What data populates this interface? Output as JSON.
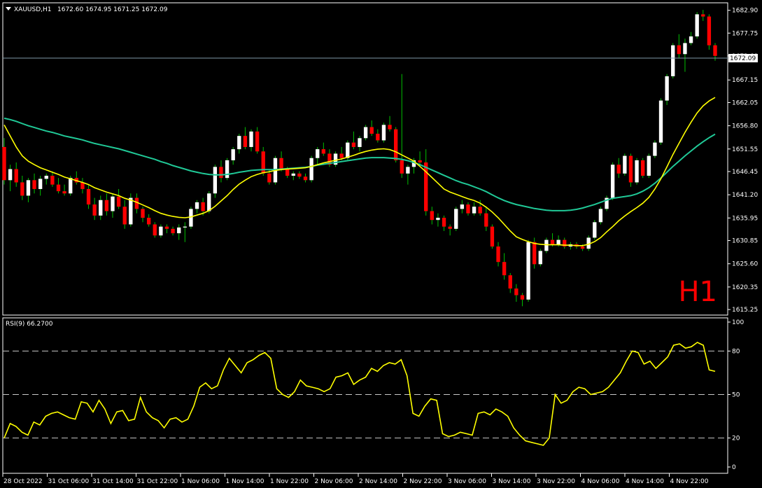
{
  "header": {
    "symbol_label": "XAUUSD,H1",
    "ohlc": "1672.60 1674.95 1671.25 1672.09"
  },
  "colors": {
    "background": "#000000",
    "frame": "#ffffff",
    "up_candle": "#ffffff",
    "down_candle": "#ff0000",
    "wick": "#00c000",
    "ma_fast": "#ffff00",
    "ma_slow": "#20c997",
    "rsi_line": "#ffff00",
    "level_dash": "#c8c8c8",
    "price_line": "#7f98a8",
    "timeframe_text": "#ff0000"
  },
  "timeframe_badge": "H1",
  "chart_data": [
    {
      "type": "candlestick",
      "title": "XAUUSD,H1",
      "ylim": [
        1614.0,
        1684.6
      ],
      "y_ticks": [
        "1682.90",
        "1677.75",
        "1672.60",
        "1667.15",
        "1662.05",
        "1656.80",
        "1651.55",
        "1646.45",
        "1641.20",
        "1635.95",
        "1630.85",
        "1625.60",
        "1620.35",
        "1615.25"
      ],
      "current_price": "1672.09",
      "x_tick_labels": [
        "28 Oct 2022",
        "31 Oct 06:00",
        "31 Oct 14:00",
        "31 Oct 22:00",
        "1 Nov 06:00",
        "1 Nov 14:00",
        "1 Nov 22:00",
        "2 Nov 06:00",
        "2 Nov 14:00",
        "2 Nov 22:00",
        "3 Nov 06:00",
        "3 Nov 14:00",
        "3 Nov 22:00",
        "4 Nov 06:00",
        "4 Nov 14:00",
        "4 Nov 22:00"
      ],
      "candles": [
        [
          1652.0,
          1654.0,
          1643.5,
          1644.5
        ],
        [
          1644.5,
          1648.0,
          1642.0,
          1647.0
        ],
        [
          1647.0,
          1648.5,
          1643.0,
          1644.0
        ],
        [
          1644.0,
          1645.5,
          1640.0,
          1641.0
        ],
        [
          1641.0,
          1645.0,
          1639.5,
          1644.5
        ],
        [
          1644.5,
          1646.0,
          1641.5,
          1642.5
        ],
        [
          1642.5,
          1645.5,
          1641.0,
          1644.8
        ],
        [
          1644.8,
          1646.0,
          1643.5,
          1645.5
        ],
        [
          1645.5,
          1646.5,
          1643.0,
          1643.5
        ],
        [
          1643.5,
          1645.0,
          1641.5,
          1642.0
        ],
        [
          1642.0,
          1643.5,
          1641.0,
          1641.5
        ],
        [
          1641.5,
          1645.5,
          1641.0,
          1645.0
        ],
        [
          1645.0,
          1646.5,
          1643.5,
          1644.0
        ],
        [
          1644.0,
          1645.0,
          1641.5,
          1642.5
        ],
        [
          1642.5,
          1643.5,
          1638.0,
          1639.0
        ],
        [
          1639.0,
          1640.5,
          1635.5,
          1636.5
        ],
        [
          1636.5,
          1641.0,
          1635.5,
          1640.0
        ],
        [
          1640.0,
          1641.5,
          1636.5,
          1637.5
        ],
        [
          1637.5,
          1641.5,
          1636.0,
          1640.8
        ],
        [
          1640.8,
          1642.5,
          1638.0,
          1638.5
        ],
        [
          1638.5,
          1640.0,
          1633.5,
          1634.5
        ],
        [
          1634.5,
          1641.5,
          1634.0,
          1640.5
        ],
        [
          1640.5,
          1641.5,
          1637.0,
          1638.0
        ],
        [
          1638.0,
          1638.5,
          1635.0,
          1636.0
        ],
        [
          1636.0,
          1636.8,
          1634.0,
          1634.5
        ],
        [
          1634.5,
          1635.0,
          1631.5,
          1632.0
        ],
        [
          1632.0,
          1634.5,
          1631.5,
          1634.0
        ],
        [
          1634.0,
          1634.5,
          1632.5,
          1633.5
        ],
        [
          1633.5,
          1634.0,
          1632.0,
          1632.5
        ],
        [
          1632.5,
          1634.5,
          1631.0,
          1633.8
        ],
        [
          1633.8,
          1635.0,
          1630.5,
          1634.0
        ],
        [
          1634.0,
          1638.5,
          1633.5,
          1638.0
        ],
        [
          1638.0,
          1640.0,
          1637.0,
          1639.5
        ],
        [
          1639.5,
          1640.5,
          1636.5,
          1637.5
        ],
        [
          1637.5,
          1642.0,
          1637.0,
          1641.5
        ],
        [
          1641.5,
          1648.0,
          1640.5,
          1647.5
        ],
        [
          1647.5,
          1649.0,
          1644.0,
          1645.0
        ],
        [
          1645.0,
          1649.5,
          1644.5,
          1649.0
        ],
        [
          1649.0,
          1652.0,
          1648.0,
          1651.5
        ],
        [
          1651.5,
          1655.0,
          1650.5,
          1654.5
        ],
        [
          1654.5,
          1656.5,
          1651.5,
          1652.0
        ],
        [
          1652.0,
          1656.0,
          1651.0,
          1655.5
        ],
        [
          1655.5,
          1656.5,
          1650.5,
          1651.0
        ],
        [
          1651.0,
          1652.0,
          1645.5,
          1646.0
        ],
        [
          1646.0,
          1647.0,
          1643.5,
          1644.0
        ],
        [
          1644.0,
          1650.0,
          1643.5,
          1649.5
        ],
        [
          1649.5,
          1651.0,
          1646.5,
          1647.0
        ],
        [
          1647.0,
          1647.5,
          1645.0,
          1645.5
        ],
        [
          1645.5,
          1646.5,
          1644.5,
          1646.0
        ],
        [
          1646.0,
          1646.5,
          1644.8,
          1645.3
        ],
        [
          1645.3,
          1646.0,
          1644.0,
          1644.5
        ],
        [
          1644.5,
          1650.0,
          1644.0,
          1649.5
        ],
        [
          1649.5,
          1652.0,
          1648.0,
          1651.5
        ],
        [
          1651.5,
          1653.0,
          1650.0,
          1650.5
        ],
        [
          1650.5,
          1651.5,
          1647.5,
          1648.0
        ],
        [
          1648.0,
          1651.0,
          1647.5,
          1650.5
        ],
        [
          1650.5,
          1652.0,
          1649.0,
          1649.5
        ],
        [
          1649.5,
          1653.5,
          1649.0,
          1653.0
        ],
        [
          1653.0,
          1655.5,
          1651.5,
          1652.0
        ],
        [
          1652.0,
          1654.5,
          1651.0,
          1654.0
        ],
        [
          1654.0,
          1657.0,
          1653.5,
          1656.5
        ],
        [
          1656.5,
          1658.0,
          1654.5,
          1655.0
        ],
        [
          1655.0,
          1656.0,
          1653.0,
          1653.5
        ],
        [
          1653.5,
          1657.5,
          1653.0,
          1657.0
        ],
        [
          1657.0,
          1659.0,
          1655.5,
          1656.0
        ],
        [
          1656.0,
          1656.5,
          1648.5,
          1649.0
        ],
        [
          1649.0,
          1668.5,
          1645.0,
          1646.0
        ],
        [
          1646.0,
          1648.0,
          1643.5,
          1647.5
        ],
        [
          1647.5,
          1649.5,
          1646.0,
          1649.0
        ],
        [
          1649.0,
          1651.0,
          1647.5,
          1648.5
        ],
        [
          1648.5,
          1651.5,
          1636.5,
          1637.5
        ],
        [
          1637.5,
          1638.5,
          1634.5,
          1635.5
        ],
        [
          1635.5,
          1637.0,
          1634.0,
          1636.0
        ],
        [
          1636.0,
          1636.5,
          1633.0,
          1634.0
        ],
        [
          1634.0,
          1634.5,
          1632.0,
          1633.5
        ],
        [
          1633.5,
          1638.5,
          1633.0,
          1638.0
        ],
        [
          1638.0,
          1640.0,
          1637.0,
          1639.0
        ],
        [
          1639.0,
          1639.5,
          1636.5,
          1637.0
        ],
        [
          1637.0,
          1639.5,
          1636.5,
          1638.5
        ],
        [
          1638.5,
          1640.0,
          1636.5,
          1637.0
        ],
        [
          1637.0,
          1638.5,
          1633.0,
          1634.0
        ],
        [
          1634.0,
          1634.5,
          1629.0,
          1629.5
        ],
        [
          1629.5,
          1630.5,
          1625.0,
          1626.0
        ],
        [
          1626.0,
          1628.0,
          1622.0,
          1623.0
        ],
        [
          1623.0,
          1623.5,
          1619.0,
          1620.0
        ],
        [
          1620.0,
          1621.0,
          1617.0,
          1618.5
        ],
        [
          1618.5,
          1619.0,
          1616.0,
          1617.5
        ],
        [
          1617.5,
          1631.0,
          1617.0,
          1630.5
        ],
        [
          1630.5,
          1631.5,
          1624.5,
          1625.5
        ],
        [
          1625.5,
          1629.0,
          1625.0,
          1628.5
        ],
        [
          1628.5,
          1631.5,
          1628.0,
          1631.0
        ],
        [
          1631.0,
          1632.5,
          1629.5,
          1630.0
        ],
        [
          1630.0,
          1632.0,
          1629.5,
          1631.0
        ],
        [
          1631.0,
          1631.5,
          1629.0,
          1629.5
        ],
        [
          1629.5,
          1630.5,
          1628.8,
          1630.0
        ],
        [
          1630.0,
          1630.5,
          1629.0,
          1629.5
        ],
        [
          1629.5,
          1630.0,
          1628.5,
          1629.0
        ],
        [
          1629.0,
          1632.0,
          1628.5,
          1631.5
        ],
        [
          1631.5,
          1635.5,
          1631.0,
          1635.0
        ],
        [
          1635.0,
          1638.5,
          1634.5,
          1638.0
        ],
        [
          1638.0,
          1641.0,
          1637.5,
          1640.5
        ],
        [
          1640.5,
          1648.5,
          1640.0,
          1648.0
        ],
        [
          1648.0,
          1649.5,
          1645.0,
          1646.0
        ],
        [
          1646.0,
          1650.5,
          1645.5,
          1650.0
        ],
        [
          1650.0,
          1650.5,
          1643.0,
          1644.0
        ],
        [
          1644.0,
          1649.5,
          1643.5,
          1649.0
        ],
        [
          1649.0,
          1649.5,
          1645.0,
          1645.5
        ],
        [
          1645.5,
          1650.5,
          1645.0,
          1650.0
        ],
        [
          1650.0,
          1653.5,
          1649.5,
          1653.0
        ],
        [
          1653.0,
          1663.0,
          1652.5,
          1662.5
        ],
        [
          1662.5,
          1668.5,
          1661.5,
          1668.0
        ],
        [
          1668.0,
          1675.5,
          1667.5,
          1675.0
        ],
        [
          1675.0,
          1677.5,
          1672.0,
          1673.0
        ],
        [
          1673.0,
          1676.5,
          1669.0,
          1675.5
        ],
        [
          1675.5,
          1678.0,
          1675.0,
          1677.0
        ],
        [
          1677.0,
          1682.5,
          1676.5,
          1682.0
        ],
        [
          1682.0,
          1683.0,
          1680.5,
          1681.5
        ],
        [
          1681.5,
          1682.0,
          1674.0,
          1675.0
        ],
        [
          1675.0,
          1675.5,
          1671.5,
          1672.6
        ]
      ],
      "ma_fast": [
        1657.0,
        1654.5,
        1652.0,
        1650.0,
        1648.8,
        1648.0,
        1647.3,
        1646.8,
        1646.3,
        1645.8,
        1645.2,
        1644.8,
        1644.4,
        1644.0,
        1643.5,
        1642.8,
        1642.3,
        1641.8,
        1641.4,
        1641.0,
        1640.4,
        1640.0,
        1639.5,
        1638.9,
        1638.3,
        1637.6,
        1637.0,
        1636.6,
        1636.3,
        1636.1,
        1636.0,
        1636.2,
        1636.6,
        1637.0,
        1637.6,
        1638.6,
        1639.8,
        1641.0,
        1642.4,
        1643.6,
        1644.5,
        1645.3,
        1645.8,
        1646.2,
        1646.4,
        1646.7,
        1646.9,
        1647.0,
        1647.1,
        1647.2,
        1647.3,
        1647.6,
        1648.0,
        1648.4,
        1648.7,
        1649.0,
        1649.3,
        1649.7,
        1650.1,
        1650.6,
        1651.0,
        1651.3,
        1651.5,
        1651.6,
        1651.4,
        1650.9,
        1650.2,
        1649.5,
        1648.8,
        1647.6,
        1646.4,
        1645.1,
        1643.8,
        1642.5,
        1641.8,
        1641.3,
        1640.8,
        1640.3,
        1639.9,
        1639.3,
        1638.4,
        1637.3,
        1636.0,
        1634.5,
        1633.0,
        1631.7,
        1631.1,
        1630.6,
        1630.2,
        1630.0,
        1629.9,
        1629.9,
        1629.9,
        1629.8,
        1629.8,
        1629.7,
        1629.7,
        1630.0,
        1630.6,
        1631.5,
        1632.8,
        1634.0,
        1635.3,
        1636.4,
        1637.4,
        1638.3,
        1639.3,
        1640.6,
        1642.5,
        1644.8,
        1647.5,
        1650.3,
        1652.8,
        1655.3,
        1657.6,
        1659.7,
        1661.3,
        1662.4,
        1663.2
      ],
      "ma_slow": [
        1658.5,
        1658.2,
        1657.8,
        1657.3,
        1656.8,
        1656.4,
        1656.0,
        1655.6,
        1655.3,
        1654.9,
        1654.5,
        1654.2,
        1653.9,
        1653.6,
        1653.2,
        1652.8,
        1652.5,
        1652.2,
        1651.9,
        1651.6,
        1651.2,
        1650.8,
        1650.4,
        1650.0,
        1649.6,
        1649.2,
        1648.7,
        1648.3,
        1647.8,
        1647.4,
        1647.0,
        1646.6,
        1646.3,
        1646.0,
        1645.8,
        1645.7,
        1645.7,
        1645.8,
        1646.0,
        1646.3,
        1646.5,
        1646.7,
        1646.8,
        1646.9,
        1646.9,
        1646.9,
        1647.0,
        1647.1,
        1647.2,
        1647.3,
        1647.4,
        1647.6,
        1647.9,
        1648.1,
        1648.3,
        1648.5,
        1648.7,
        1648.9,
        1649.1,
        1649.3,
        1649.5,
        1649.6,
        1649.6,
        1649.6,
        1649.5,
        1649.4,
        1649.2,
        1648.9,
        1648.5,
        1648.0,
        1647.4,
        1646.8,
        1646.2,
        1645.6,
        1645.0,
        1644.4,
        1643.9,
        1643.5,
        1643.0,
        1642.5,
        1641.9,
        1641.2,
        1640.5,
        1639.9,
        1639.4,
        1639.0,
        1638.7,
        1638.4,
        1638.1,
        1637.9,
        1637.7,
        1637.6,
        1637.6,
        1637.6,
        1637.7,
        1637.9,
        1638.2,
        1638.6,
        1639.0,
        1639.5,
        1640.0,
        1640.4,
        1640.6,
        1640.8,
        1641.0,
        1641.4,
        1642.0,
        1642.8,
        1643.8,
        1645.0,
        1646.3,
        1647.6,
        1648.8,
        1650.0,
        1651.1,
        1652.2,
        1653.2,
        1654.1,
        1654.9
      ]
    },
    {
      "type": "line",
      "title": "RSI(9) 66.2700",
      "ylim": [
        0,
        100
      ],
      "y_ticks": [
        "100",
        "80",
        "50",
        "20",
        "0"
      ],
      "levels": [
        80,
        50,
        20
      ],
      "values": [
        20,
        30,
        28,
        24,
        22,
        31,
        29,
        35,
        37,
        38,
        36,
        34,
        33,
        45,
        44,
        38,
        46,
        40,
        30,
        38,
        39,
        32,
        33,
        48,
        38,
        34,
        32,
        27,
        33,
        34,
        31,
        33,
        42,
        55,
        58,
        54,
        56,
        67,
        75,
        70,
        65,
        72,
        74,
        77,
        79,
        75,
        54,
        50,
        48,
        52,
        60,
        56,
        55,
        54,
        52,
        54,
        62,
        63,
        65,
        57,
        60,
        62,
        68,
        66,
        70,
        72,
        71,
        74,
        63,
        37,
        35,
        42,
        47,
        46,
        23,
        21,
        22,
        24,
        23,
        22,
        37,
        38,
        36,
        40,
        38,
        35,
        27,
        22,
        18,
        17,
        16,
        15,
        20,
        50,
        44,
        46,
        52,
        55,
        54,
        50,
        51,
        52,
        55,
        60,
        65,
        73,
        80,
        79,
        71,
        73,
        68,
        72,
        76,
        84,
        85,
        82,
        83,
        86,
        84,
        67,
        66
      ]
    }
  ]
}
